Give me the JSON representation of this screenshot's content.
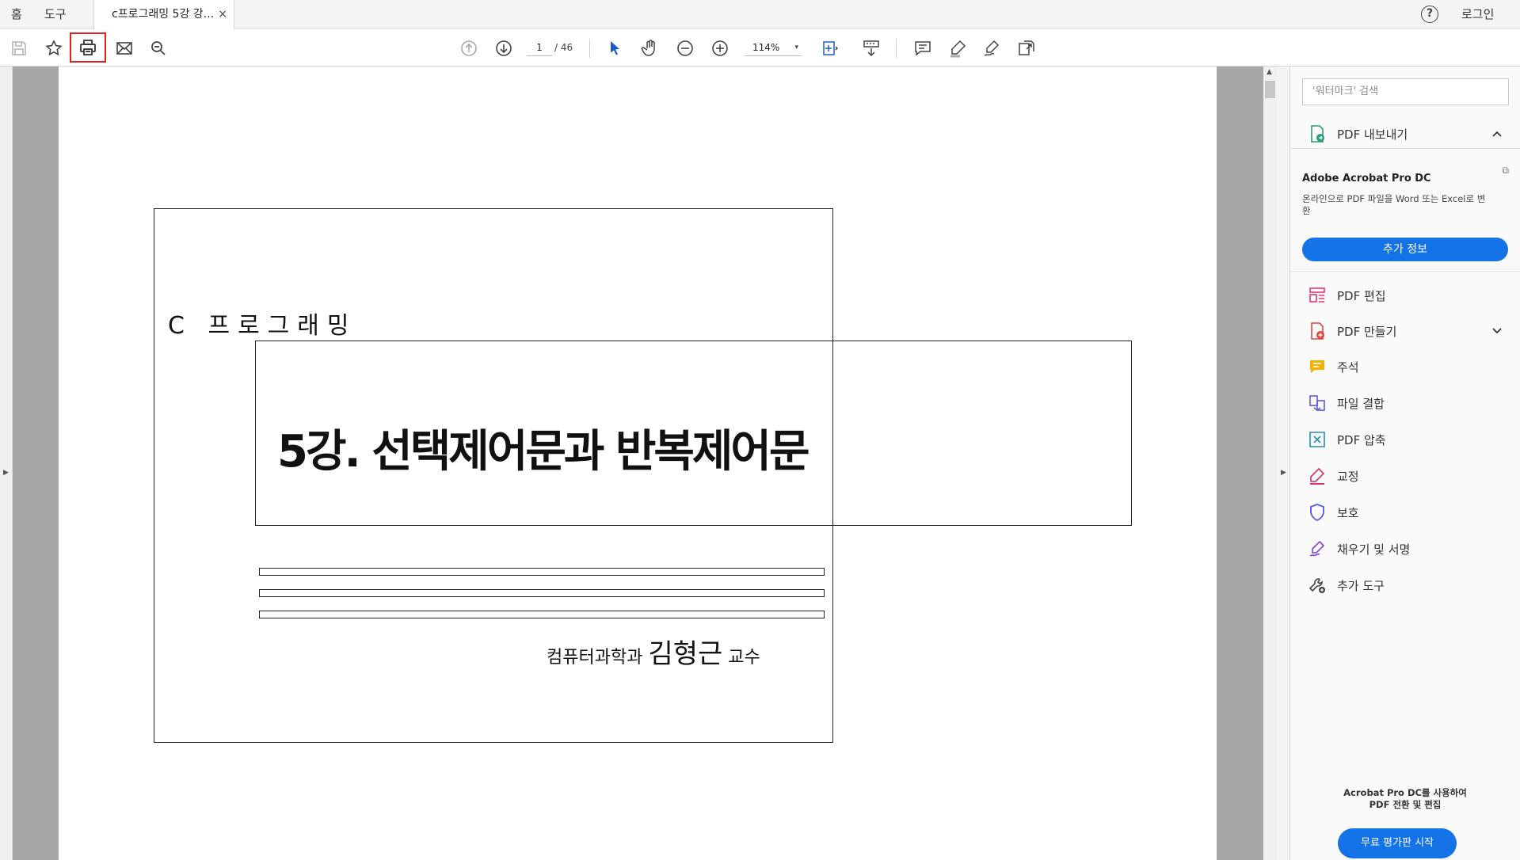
{
  "tabbar": {
    "home": "홈",
    "tools": "도구",
    "doc_tab": "c프로그래밍 5강 강...",
    "close": "×",
    "help": "?",
    "login": "로그인"
  },
  "toolbar": {
    "page_current": "1",
    "page_total": "/ 46",
    "zoom": "114%",
    "zoom_caret": "▾"
  },
  "slide": {
    "subtitle": "C 프로그래밍",
    "title": "5강. 선택제어문과 반복제어문",
    "dept": "컴퓨터과학과 ",
    "name": "김형근",
    "role": " 교수"
  },
  "rightpane": {
    "search_placeholder": "'워터마크' 검색",
    "export_label": "PDF 내보내기",
    "promo_title": "Adobe Acrobat Pro DC",
    "promo_desc": "온라인으로 PDF 파일을 Word 또는 Excel로 변환",
    "promo_button": "추가 정보",
    "tools": [
      {
        "label": "PDF 편집"
      },
      {
        "label": "PDF 만들기"
      },
      {
        "label": "주석"
      },
      {
        "label": "파일 결합"
      },
      {
        "label": "PDF 압축"
      },
      {
        "label": "교정"
      },
      {
        "label": "보호"
      },
      {
        "label": "채우기 및 서명"
      },
      {
        "label": "추가 도구"
      }
    ],
    "bottom_line1": "Acrobat Pro DC를 사용하여",
    "bottom_line2": "PDF 전환 및 편집",
    "trial_button": "무료 평가판 시작"
  },
  "colors": {
    "accent": "#1473e6",
    "highlight_border": "#e02020",
    "viewer_bg": "#a7a7a7"
  },
  "icons": [
    "save-icon",
    "star-icon",
    "print-icon",
    "mail-icon",
    "search-icon",
    "page-up-icon",
    "page-down-icon",
    "cursor-icon",
    "hand-icon",
    "zoom-out-icon",
    "zoom-in-icon",
    "fit-page-icon",
    "scroll-mode-icon",
    "comment-icon",
    "highlight-icon",
    "sign-icon",
    "share-icon"
  ]
}
